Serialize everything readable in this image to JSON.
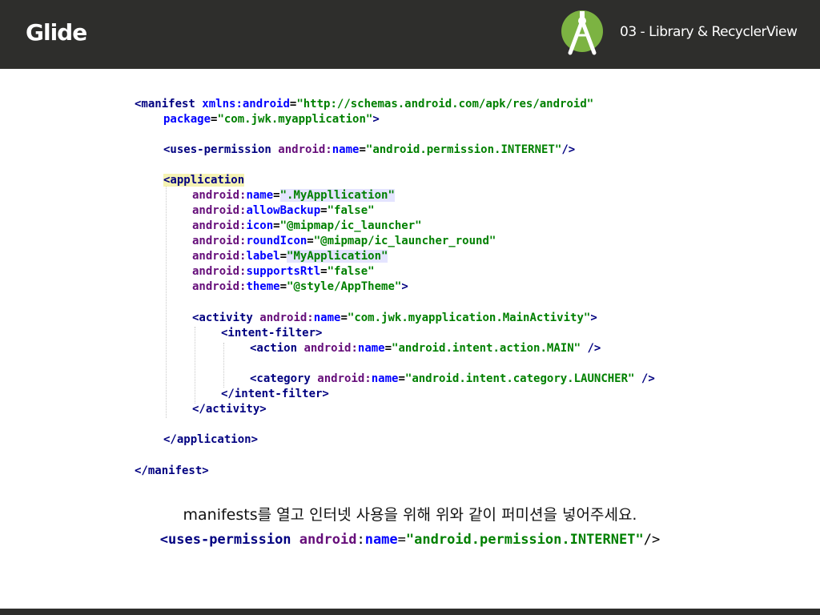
{
  "header": {
    "title": "Glide",
    "subtitle": "03 - Library & RecyclerView",
    "logo_icon": "android-studio-icon",
    "background_color": "#2e2e2c"
  },
  "code": {
    "l1_open": "<manifest",
    "l1_attr": "xmlns:android",
    "l1_eq": "=",
    "l1_val": "\"http://schemas.android.com/apk/res/android\"",
    "l2_attr": "package",
    "l2_eq": "=",
    "l2_val": "\"com.jwk.myapplication\"",
    "l2_close": ">",
    "l3_open": "<uses-permission",
    "l3_ns": "android:",
    "l3_attr": "name",
    "l3_eq": "=",
    "l3_val": "\"android.permission.INTERNET\"",
    "l3_close": "/>",
    "l4_open": "<application",
    "l5_ns": "android:",
    "l5_attr": "name",
    "l5_eq": "=",
    "l5_val": "\".MyAppllication\"",
    "l6_ns": "android:",
    "l6_attr": "allowBackup",
    "l6_eq": "=",
    "l6_val": "\"false\"",
    "l7_ns": "android:",
    "l7_attr": "icon",
    "l7_eq": "=",
    "l7_val": "\"@mipmap/ic_launcher\"",
    "l8_ns": "android:",
    "l8_attr": "roundIcon",
    "l8_eq": "=",
    "l8_val": "\"@mipmap/ic_launcher_round\"",
    "l9_ns": "android:",
    "l9_attr": "label",
    "l9_eq": "=",
    "l9_val": "\"MyApplication\"",
    "l10_ns": "android:",
    "l10_attr": "supportsRtl",
    "l10_eq": "=",
    "l10_val": "\"false\"",
    "l11_ns": "android:",
    "l11_attr": "theme",
    "l11_eq": "=",
    "l11_val": "\"@style/AppTheme\"",
    "l11_close": ">",
    "l12_open": "<activity",
    "l12_ns": "android:",
    "l12_attr": "name",
    "l12_eq": "=",
    "l12_val": "\"com.jwk.myapplication.MainActivity\"",
    "l12_close": ">",
    "l13_open": "<intent-filter",
    "l13_close": ">",
    "l14_open": "<action",
    "l14_ns": "android:",
    "l14_attr": "name",
    "l14_eq": "=",
    "l14_val": "\"android.intent.action.MAIN\"",
    "l14_close": " />",
    "l15_open": "<category",
    "l15_ns": "android:",
    "l15_attr": "name",
    "l15_eq": "=",
    "l15_val": "\"android.intent.category.LAUNCHER\"",
    "l15_close": " />",
    "l16_close": "</intent-filter>",
    "l17_close": "</activity>",
    "l18_close": "</application>",
    "l19_close": "</manifest>"
  },
  "caption": "manifests를 열고 인터넷 사용을 위해 위와 같이 퍼미션을 넣어주세요.",
  "snippet": {
    "open": "<uses-permission",
    "ns": "android",
    "colon": ":",
    "name": "name",
    "eq": "=",
    "val": "\"android.permission.INTERNET\"",
    "close": "/>"
  }
}
